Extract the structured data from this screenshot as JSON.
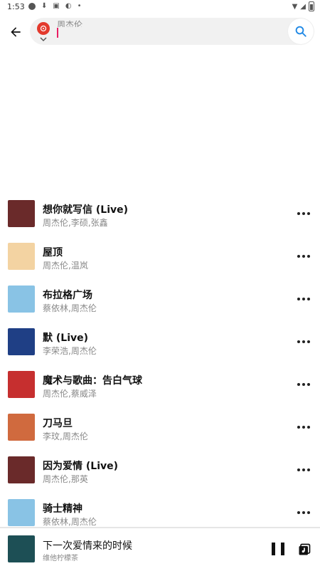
{
  "status": {
    "time": "1:53"
  },
  "search": {
    "query": "周杰伦"
  },
  "songs": [
    {
      "title": "想你就写信 (Live)",
      "artist": "周杰伦,李硕,张鑫",
      "cover_color": "#6a2a2a"
    },
    {
      "title": "屋顶",
      "artist": "周杰伦,温岚",
      "cover_color": "#f3d3a2"
    },
    {
      "title": "布拉格广场",
      "artist": "蔡依林,周杰伦",
      "cover_color": "#89c3e5"
    },
    {
      "title": "默 (Live)",
      "artist": "李荣浩,周杰伦",
      "cover_color": "#1f3f85"
    },
    {
      "title": "魔术与歌曲：告白气球",
      "artist": "周杰伦,蔡威泽",
      "cover_color": "#c62f2f"
    },
    {
      "title": "刀马旦",
      "artist": "李玟,周杰伦",
      "cover_color": "#d06a3e"
    },
    {
      "title": "因为爱情 (Live)",
      "artist": "周杰伦,那英",
      "cover_color": "#6a2a2a"
    },
    {
      "title": "骑士精神",
      "artist": "蔡依林,周杰伦",
      "cover_color": "#89c3e5"
    }
  ],
  "now_playing": {
    "title": "下一次爱情来的时候",
    "artist": "维他柠檬茶",
    "cover_color": "#1d4f55"
  },
  "colors": {
    "accent": "#e33a2d",
    "search_icon": "#1e88e5"
  }
}
